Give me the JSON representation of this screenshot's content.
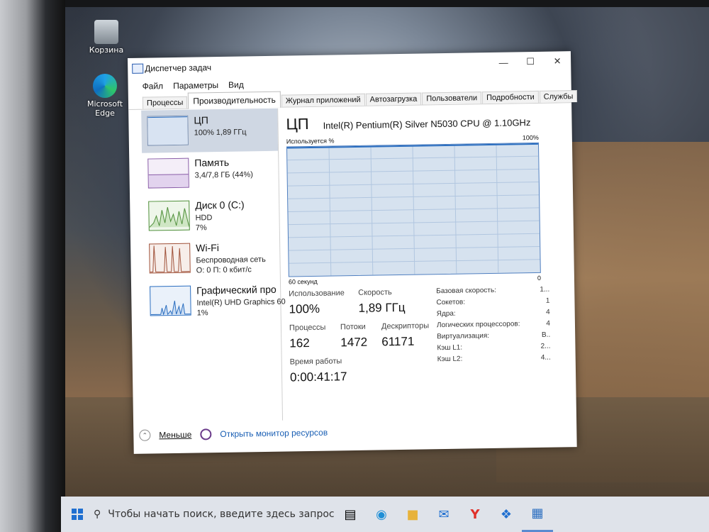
{
  "desktop": {
    "icons": [
      {
        "label": "Корзина",
        "icon": "recycle-bin-icon"
      },
      {
        "label": "Microsoft Edge",
        "icon": "edge-icon"
      }
    ]
  },
  "window": {
    "title": "Диспетчер задач",
    "menu": [
      "Файл",
      "Параметры",
      "Вид"
    ],
    "tabs": [
      "Процессы",
      "Производительность",
      "Журнал приложений",
      "Автозагрузка",
      "Пользователи",
      "Подробности",
      "Службы"
    ],
    "active_tab": "Производительность"
  },
  "sidebar": {
    "items": [
      {
        "name": "ЦП",
        "line1": "100% 1,89 ГГц",
        "line2": "",
        "selected": true
      },
      {
        "name": "Память",
        "line1": "3,4/7,8 ГБ (44%)",
        "line2": ""
      },
      {
        "name": "Диск 0 (C:)",
        "line1": "HDD",
        "line2": "7%"
      },
      {
        "name": "Wi-Fi",
        "line1": "Беспроводная сеть",
        "line2": "О: 0 П: 0 кбит/с"
      },
      {
        "name": "Графический про",
        "line1": "Intel(R) UHD Graphics 60",
        "line2": "1%"
      }
    ]
  },
  "cpu": {
    "title": "ЦП",
    "model": "Intel(R) Pentium(R) Silver N5030 CPU @ 1.10GHz",
    "graph_label": "Используется %",
    "graph_max": "100%",
    "graph_time": "60 секунд",
    "graph_min": "0",
    "usage_percent": 100,
    "stats": {
      "usage_label": "Использование",
      "usage_value": "100%",
      "speed_label": "Скорость",
      "speed_value": "1,89 ГГц",
      "processes_label": "Процессы",
      "processes_value": "162",
      "threads_label": "Потоки",
      "threads_value": "1472",
      "handles_label": "Дескрипторы",
      "handles_value": "61171",
      "uptime_label": "Время работы",
      "uptime_value": "0:00:41:17"
    },
    "specs": [
      {
        "label": "Базовая скорость:",
        "value": "1..."
      },
      {
        "label": "Сокетов:",
        "value": "1"
      },
      {
        "label": "Ядра:",
        "value": "4"
      },
      {
        "label": "Логических процессоров:",
        "value": "4"
      },
      {
        "label": "Виртуализация:",
        "value": "В.."
      },
      {
        "label": "Кэш L1:",
        "value": "2..."
      },
      {
        "label": "Кэш L2:",
        "value": "4..."
      }
    ]
  },
  "footer": {
    "less": "Меньше",
    "resmon": "Открыть монитор ресурсов"
  },
  "taskbar": {
    "search_placeholder": "Чтобы начать поиск, введите здесь запрос"
  }
}
